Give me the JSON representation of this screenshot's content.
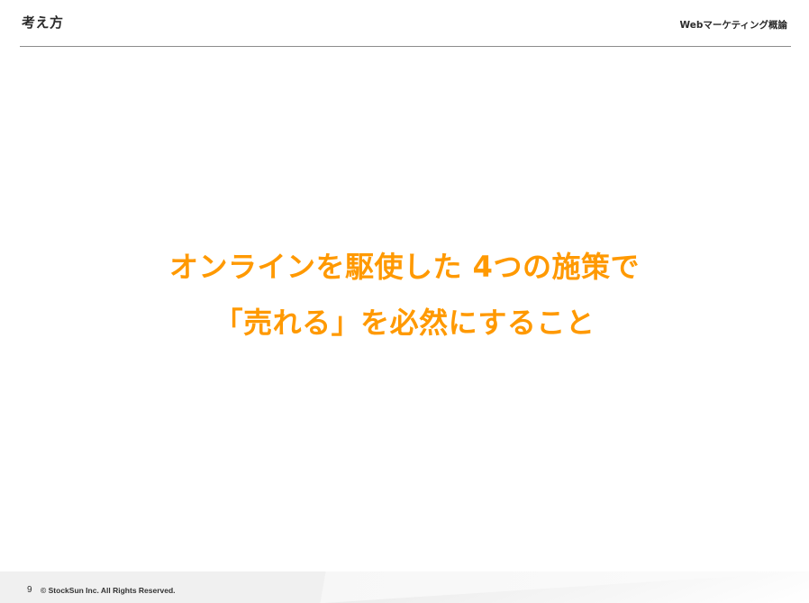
{
  "header": {
    "title": "考え方",
    "deck_name": "Webマーケティング概論"
  },
  "main": {
    "message_lines": [
      "オンラインを駆使した 4つの施策で",
      "「売れる」を必然にすること"
    ]
  },
  "footer": {
    "page_number": "9",
    "copyright": "© StockSun Inc. All Rights Reserved."
  },
  "colors": {
    "accent": "#ff9900",
    "text": "#2b2b2b",
    "rule": "#8c8c8c"
  }
}
